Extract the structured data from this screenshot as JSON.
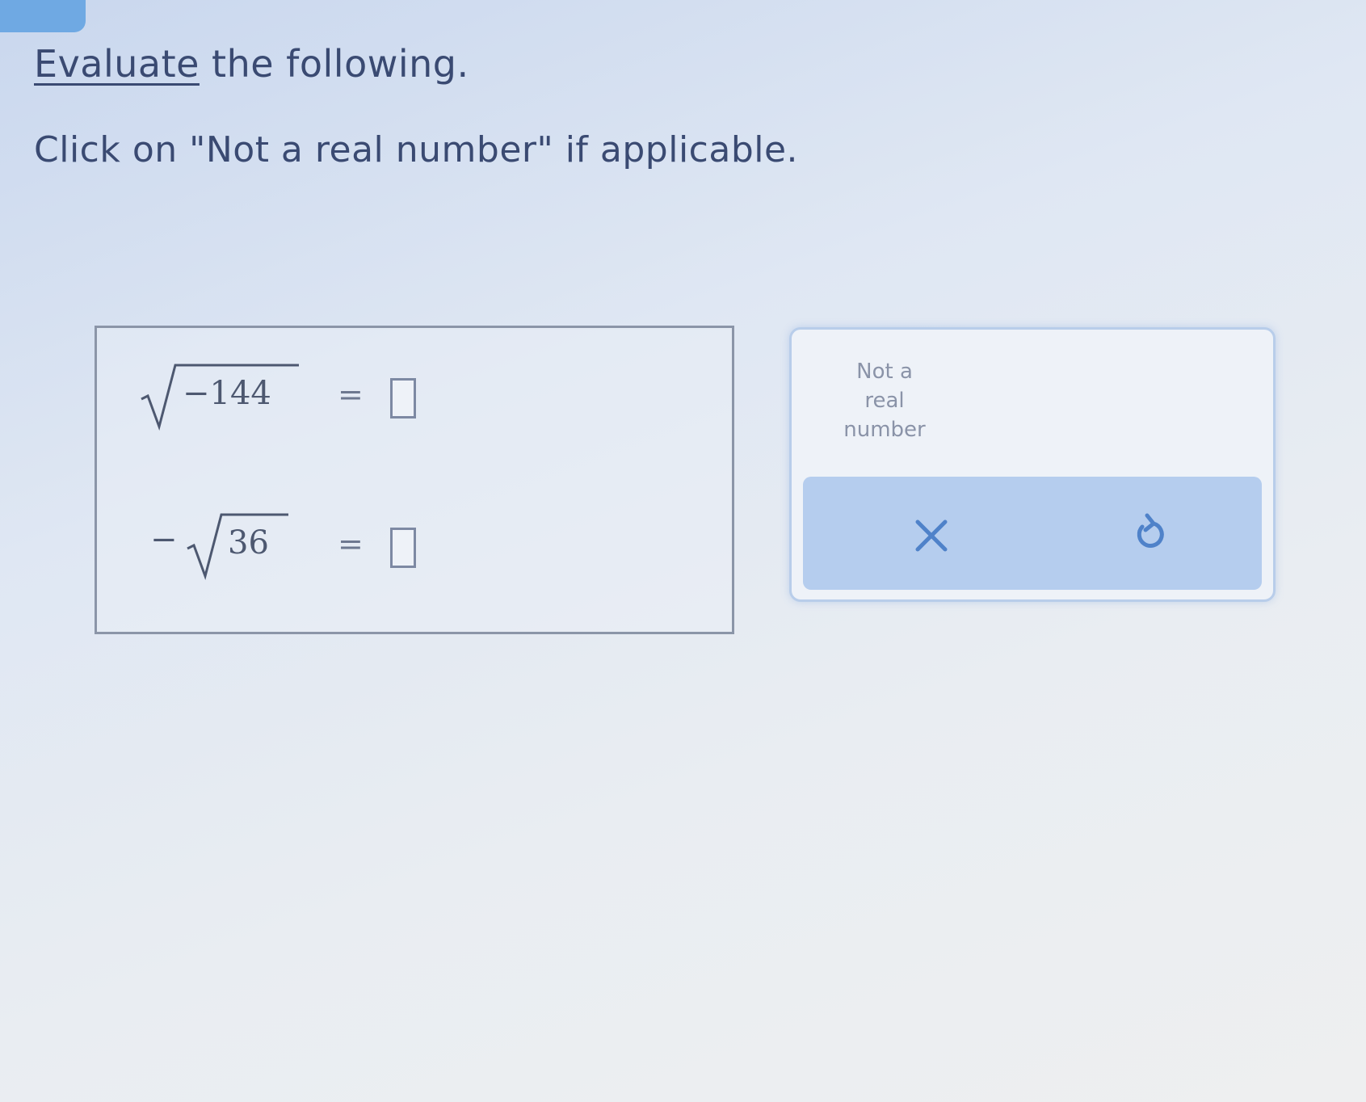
{
  "header": {
    "title_link": "Evaluate",
    "title_rest": " the following."
  },
  "instruction": "Click on \"Not a real number\" if applicable.",
  "problems": [
    {
      "negated": "",
      "radicand": "−144",
      "equals": "=",
      "answer": ""
    },
    {
      "negated": "−",
      "radicand": "36",
      "equals": "=",
      "answer": ""
    }
  ],
  "keypad": {
    "not_real_line1": "Not a",
    "not_real_line2": "real",
    "not_real_line3": "number",
    "clear_icon": "x-icon",
    "undo_icon": "undo-icon"
  },
  "colors": {
    "accent": "#6fa9e3",
    "action_bar": "#b5cdee",
    "text": "#3a4a72"
  }
}
